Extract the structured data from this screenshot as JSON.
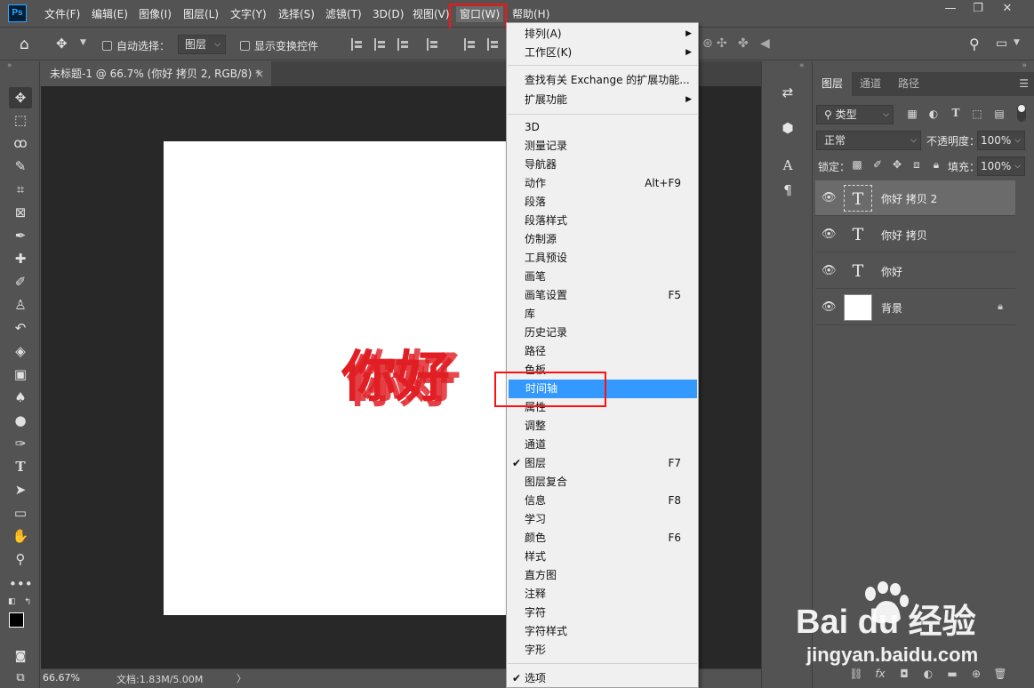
{
  "app": {
    "logo": "Ps"
  },
  "menubar": {
    "items": [
      "文件(F)",
      "编辑(E)",
      "图像(I)",
      "图层(L)",
      "文字(Y)",
      "选择(S)",
      "滤镜(T)",
      "3D(D)",
      "视图(V)",
      "窗口(W)",
      "帮助(H)"
    ],
    "active": "窗口(W)"
  },
  "window_controls": {
    "minimize": "—",
    "restore": "❐",
    "close": "✕"
  },
  "options": {
    "auto_select_label": "自动选择：",
    "auto_select_target": "图层",
    "show_transform_label": "显示变换控件"
  },
  "document": {
    "tab_title": "未标题-1 @ 66.7% (你好 拷贝 2, RGB/8) *",
    "close": "×",
    "canvas_text": "你好",
    "text_color": "#e01e24"
  },
  "status": {
    "zoom": "66.67%",
    "doc_info": "文档:1.83M/5.00M",
    "caret": "〉"
  },
  "window_menu": {
    "items": [
      {
        "label": "排列(A)",
        "submenu": "▶"
      },
      {
        "label": "工作区(K)",
        "submenu": "▶"
      },
      {
        "label": "查找有关 Exchange 的扩展功能..."
      },
      {
        "label": "扩展功能",
        "submenu": "▶"
      },
      {
        "label": "3D"
      },
      {
        "label": "测量记录"
      },
      {
        "label": "导航器"
      },
      {
        "label": "动作",
        "shortcut": "Alt+F9"
      },
      {
        "label": "段落"
      },
      {
        "label": "段落样式"
      },
      {
        "label": "仿制源"
      },
      {
        "label": "工具预设"
      },
      {
        "label": "画笔"
      },
      {
        "label": "画笔设置",
        "shortcut": "F5"
      },
      {
        "label": "库"
      },
      {
        "label": "历史记录"
      },
      {
        "label": "路径"
      },
      {
        "label": "色板"
      },
      {
        "label": "时间轴"
      },
      {
        "label": "属性"
      },
      {
        "label": "调整"
      },
      {
        "label": "通道"
      },
      {
        "label": "图层",
        "shortcut": "F7",
        "check": "✔"
      },
      {
        "label": "图层复合"
      },
      {
        "label": "信息",
        "shortcut": "F8"
      },
      {
        "label": "学习"
      },
      {
        "label": "颜色",
        "shortcut": "F6"
      },
      {
        "label": "样式"
      },
      {
        "label": "直方图"
      },
      {
        "label": "注释"
      },
      {
        "label": "字符"
      },
      {
        "label": "字符样式"
      },
      {
        "label": "字形"
      },
      {
        "label": "选项",
        "check": "✔"
      }
    ],
    "highlighted": "时间轴"
  },
  "layers_panel": {
    "tabs": [
      "图层",
      "通道",
      "路径"
    ],
    "filter_kind": "类型",
    "blend_mode": "正常",
    "opacity_label": "不透明度：",
    "opacity": "100%",
    "lock_label": "锁定：",
    "fill_label": "填充：",
    "fill": "100%",
    "layers": [
      {
        "name": "你好 拷贝 2",
        "type": "text",
        "selected": true
      },
      {
        "name": "你好 拷贝",
        "type": "text"
      },
      {
        "name": "你好",
        "type": "text"
      },
      {
        "name": "背景",
        "type": "background",
        "locked": true
      }
    ]
  },
  "watermark": {
    "logo": "Bai du 经验",
    "url": "jingyan.baidu.com"
  },
  "colors": {
    "accent": "#3399ff",
    "annotation": "#ff1010",
    "panel_bg": "#535353",
    "canvas_bg": "#282828"
  }
}
